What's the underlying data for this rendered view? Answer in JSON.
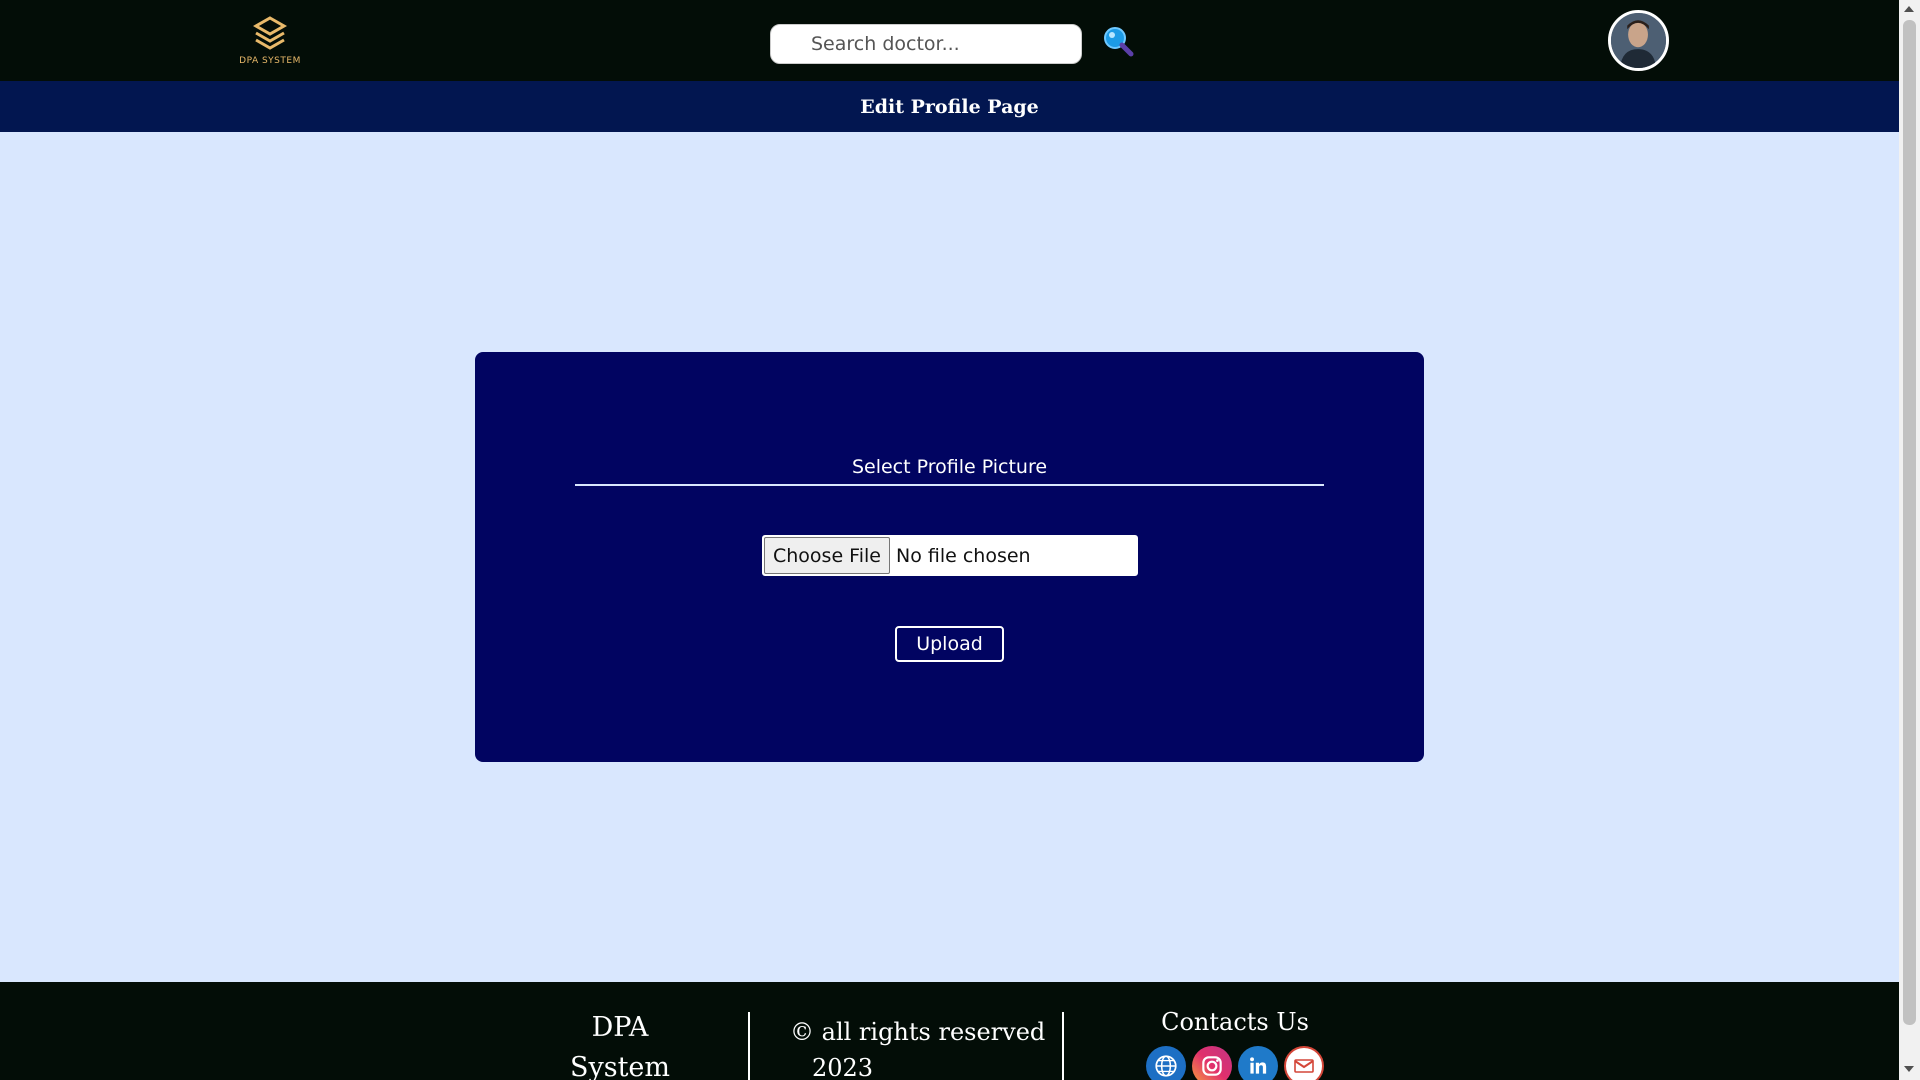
{
  "header": {
    "logo_text": "DPA SYSTEM",
    "search_placeholder": "Search doctor...",
    "search_icon": "search-icon",
    "avatar": "user-avatar"
  },
  "title_bar": {
    "title": "Edit Profile Page"
  },
  "form": {
    "heading": "Select Profile Picture",
    "file_button_label": "Choose File",
    "file_status": "No file chosen",
    "upload_label": "Upload"
  },
  "footer": {
    "brand_line1": "DPA",
    "brand_line2": "System",
    "copyright_line1": "© all rights reserved",
    "copyright_line2": "2023",
    "contacts_title": "Contacts Us",
    "socials": [
      "globe-icon",
      "instagram-icon",
      "linkedin-icon",
      "gmail-icon"
    ]
  },
  "colors": {
    "topbar": "#030d07",
    "titlebar": "#021650",
    "page_bg": "#d9e7fe",
    "card_bg": "#010461",
    "logo_gold": "#e9b96a"
  }
}
